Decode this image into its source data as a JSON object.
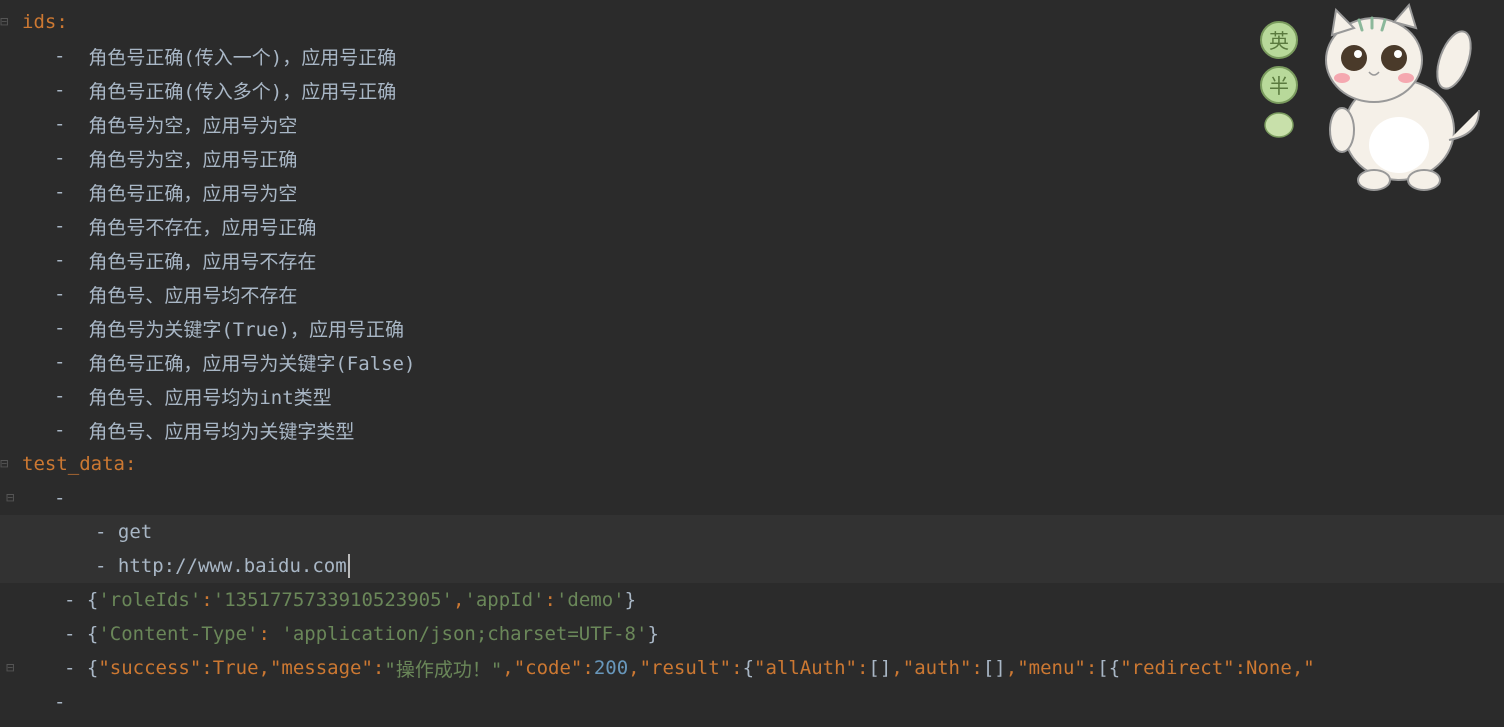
{
  "code": {
    "ids_key": "ids",
    "ids_items": [
      "角色号正确(传入一个)，应用号正确",
      "角色号正确(传入多个)，应用号正确",
      "角色号为空，应用号为空",
      "角色号为空，应用号正确",
      "角色号正确，应用号为空",
      "角色号不存在，应用号正确",
      "角色号正确，应用号不存在",
      "角色号、应用号均不存在",
      "角色号为关键字(True)，应用号正确",
      "角色号正确，应用号为关键字(False)",
      "角色号、应用号均为int类型",
      "角色号、应用号均为关键字类型"
    ],
    "test_data_key": "test_data",
    "test_entries": {
      "method": "get",
      "url": "http://www.baidu.com",
      "params_roleIds_key": "'roleIds'",
      "params_roleIds_val": "'1351775733910523905'",
      "params_appId_key": "'appId'",
      "params_appId_val": "'demo'",
      "headers_ct_key": "'Content-Type'",
      "headers_ct_val": "'application/json;charset=UTF-8'",
      "resp_success_key": "\"success\"",
      "resp_success_val": "True",
      "resp_message_key": "\"message\"",
      "resp_message_val": "\"操作成功！\"",
      "resp_code_key": "\"code\"",
      "resp_code_val": "200",
      "resp_result_key": "\"result\"",
      "resp_allAuth_key": "\"allAuth\"",
      "resp_auth_key": "\"auth\"",
      "resp_menu_key": "\"menu\"",
      "resp_redirect_key": "\"redirect\"",
      "resp_redirect_val": "None",
      "trailing": "\""
    }
  },
  "mascot": {
    "badge1": "英",
    "badge2": "半"
  }
}
